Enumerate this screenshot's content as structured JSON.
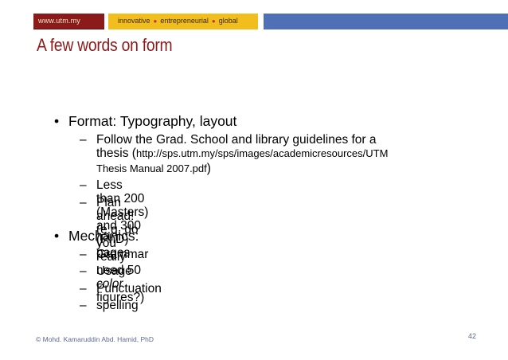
{
  "header": {
    "url": "www.utm.my",
    "tagline": [
      "innovative",
      "entrepreneurial",
      "global"
    ],
    "colors": {
      "maroon": "#8b1a1a",
      "gold": "#f1be1e",
      "blue": "#4f6fb7"
    }
  },
  "slide": {
    "title": "A few words on form",
    "bullets": [
      {
        "text": "Format:  Typography, layout",
        "sub": {
          "grad_pre": "Follow the Grad. School and library guidelines for a",
          "grad_line2_pre": "thesis (",
          "grad_link_1": "http://sps.utm.my/sps/images/academicresources/UTM",
          "grad_link_2": "Thesis Manual 2007.pdf",
          "grad_close": ")",
          "pages": "Less than 200 (Masters) and 300 (PhD) pages",
          "plan_pre": "Plan ahead! (e.g. do you really need 50 ",
          "plan_em": "color",
          "plan_line2": "figures?)"
        }
      },
      {
        "text": "Mechanics:",
        "items": [
          "Grammar",
          "Usage",
          "Punctuation",
          "spelling"
        ]
      }
    ]
  },
  "footer": {
    "credit": "© Mohd. Kamaruddin Abd. Hamid, PhD",
    "page": "42"
  }
}
